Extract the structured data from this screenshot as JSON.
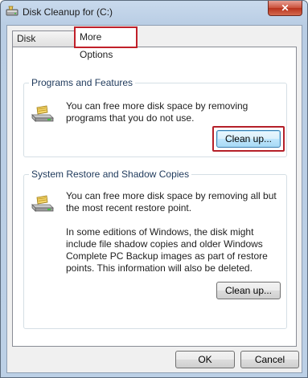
{
  "window": {
    "title": "Disk Cleanup for  (C:)",
    "close_glyph": "✕"
  },
  "tabs": [
    {
      "label": "Disk Cleanup",
      "selected": false
    },
    {
      "label": "More Options",
      "selected": true
    }
  ],
  "groups": [
    {
      "heading": "Programs and Features",
      "icon": "drive-icon",
      "paragraphs": [
        "You can free more disk space by removing programs that you do not use."
      ],
      "button_label": "Clean up..."
    },
    {
      "heading": "System Restore and Shadow Copies",
      "icon": "drive-icon",
      "paragraphs": [
        "You can free more disk space by removing all but the most recent restore point.",
        "In some editions of Windows, the disk might include file shadow copies and older Windows Complete PC Backup images as part of restore points. This information will also be deleted."
      ],
      "button_label": "Clean up..."
    }
  ],
  "footer": {
    "ok_label": "OK",
    "cancel_label": "Cancel"
  },
  "colors": {
    "highlight": "#b52029",
    "close_button": "#c9503a"
  }
}
